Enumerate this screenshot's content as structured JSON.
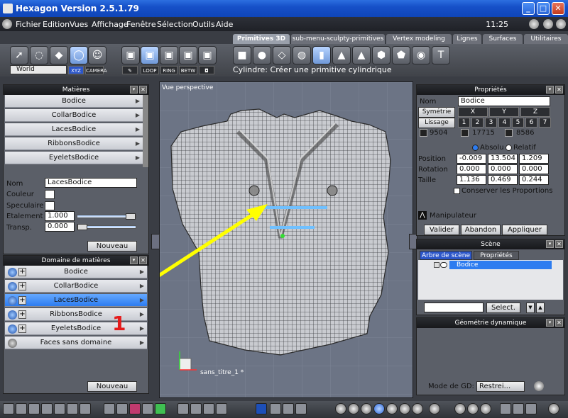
{
  "window": {
    "title": "Hexagon Version 2.5.1.79",
    "min": "_",
    "max": "□",
    "close": "✕"
  },
  "menu": {
    "items": [
      "Fichier",
      "Edition",
      "Vues",
      "Affichage",
      "Fenêtre",
      "Sélection",
      "Outils",
      "Aide"
    ],
    "clock": "11:25"
  },
  "top_tabs": [
    "Primitives 3D",
    "sub-menu-sculpty-primitives",
    "Vertex modeling",
    "Lignes",
    "Surfaces",
    "Utilitaires"
  ],
  "toolbar": {
    "coord_select": "World",
    "coord_buttons": [
      "XYZ",
      "CAMERA"
    ],
    "sel_buttons": [
      "LOOP",
      "RING",
      "BETW"
    ],
    "hint": "Cylindre: Créer une primitive cylindrique"
  },
  "materials": {
    "title": "Matières",
    "items": [
      "Bodice",
      "CollarBodice",
      "LacesBodice",
      "RibbonsBodice",
      "EyeletsBodice"
    ],
    "nom_label": "Nom",
    "nom_value": "LacesBodice",
    "couleur_label": "Couleur",
    "speculaire_label": "Speculaire",
    "etalement_label": "Etalement",
    "etalement_value": "1.000",
    "etalement_level": 1.0,
    "transp_label": "Transp.",
    "transp_value": "0.000",
    "transp_level": 0.0,
    "new_button": "Nouveau"
  },
  "domains": {
    "title": "Domaine de matières",
    "items": [
      "Bodice",
      "CollarBodice",
      "LacesBodice",
      "RibbonsBodice",
      "EyeletsBodice",
      "Faces sans domaine"
    ],
    "selected": "LacesBodice",
    "new_button": "Nouveau"
  },
  "annotation": {
    "number": "1",
    "color": "#ffff00",
    "number_color": "#e51c1c"
  },
  "viewport": {
    "label": "Vue perspective",
    "object_label": "sans_titre_1 *"
  },
  "properties": {
    "title": "Propriétés",
    "nom_label": "Nom",
    "nom_value": "Bodice",
    "symetrie": "Symétrie",
    "axes": [
      "X",
      "Y",
      "Z"
    ],
    "lissage": "Lissage",
    "levels": [
      "1",
      "2",
      "3",
      "4",
      "5",
      "6",
      "7"
    ],
    "counts": [
      "9504",
      "17715",
      "8586"
    ],
    "absolu": "Absolu",
    "relatif": "Relatif",
    "position_label": "Position",
    "position": [
      "-0.009",
      "13.504",
      "1.209"
    ],
    "rotation_label": "Rotation",
    "rotation": [
      "0.000",
      "0.000",
      "0.000"
    ],
    "taille_label": "Taille",
    "taille": [
      "1.136",
      "0.469",
      "0.244"
    ],
    "conserver": "Conserver les Proportions",
    "manipulateur": "Manipulateur",
    "valider": "Valider",
    "abandon": "Abandon",
    "appliquer": "Appliquer"
  },
  "scene": {
    "title": "Scène",
    "tabs": [
      "Arbre de scène",
      "Propriétés"
    ],
    "item": "Bodice",
    "select_button": "Select."
  },
  "geometry": {
    "title": "Géométrie dynamique",
    "mode_label": "Mode de GD:",
    "mode_value": "Restrei..."
  },
  "colors": {
    "accent": "#2d7cf0",
    "panel_bg": "#5b5f68",
    "titlebar": "#1650c8"
  }
}
